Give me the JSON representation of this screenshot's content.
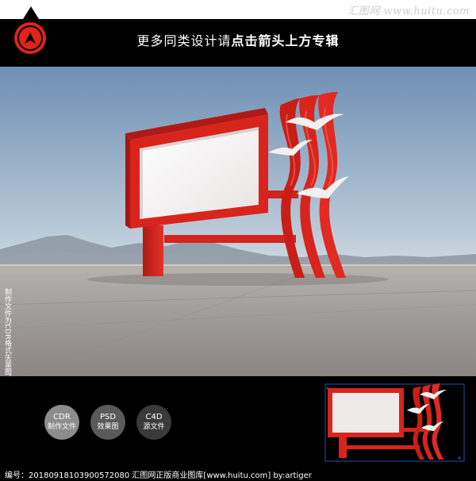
{
  "watermark": "汇图网 www.huitu.com",
  "header": {
    "text_plain": "更多同类设计请",
    "text_link": "点击箭头上方专辑"
  },
  "side_note": "制作文件为CDR格式矢量图，可无限放大，任意修改。",
  "badges": [
    {
      "title": "CDR",
      "subtitle": "制作文件"
    },
    {
      "title": "PSD",
      "subtitle": "效果图"
    },
    {
      "title": "C4D",
      "subtitle": "源文件"
    }
  ],
  "footer": "编号：20180918103900572080   汇图网正版商业图库[www.huitu.com] by:artiger",
  "colors": {
    "accent_red": "#d8241c",
    "sky_top": "#6f8fb4",
    "sky_bottom": "#c6d3de",
    "ground": "#9c9896"
  },
  "icons": {
    "nav": "arrow-up-icon"
  }
}
